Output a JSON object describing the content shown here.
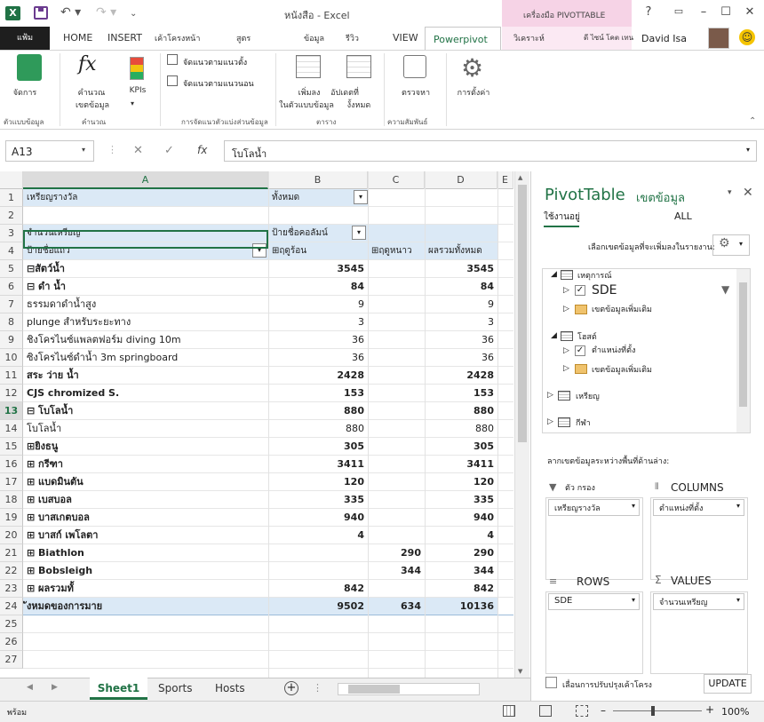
{
  "window": {
    "title": "หนังสือ - Excel",
    "context_tab": "เครื่องมือ PIVOTTABLE"
  },
  "tabs": {
    "file": "แฟ้ม",
    "home": "HOME",
    "insert": "INSERT",
    "layout": "เค้าโครงหน้า",
    "formulas": "สูตร",
    "data": "ข้อมูล",
    "review": "รีวิว",
    "view": "VIEW",
    "powerpivot": "Powerpivot",
    "analyze": "วิเคราะห์",
    "design": "ดี ไซน์ โคต เทน"
  },
  "user": {
    "name": "David Isa"
  },
  "ribbon": {
    "manage": "จัดการ",
    "group_model": "ตัวแบบข้อมูล",
    "calc": "คำนวณ",
    "calc_sub": "เขตข้อมูล",
    "kpis": "KPIs",
    "group_calc": "คำนวณ",
    "filter_col": "จัดแนวตามแนวตั้ง",
    "filter_row": "จัดแนวตามแนวนอน",
    "group_slicer": "การจัดแนวตัวแบ่งส่วนข้อมูล",
    "add_model": "เพิ่มลง",
    "add_model2": "ในตัวแบบข้อมูล",
    "update_all": "อัปเดตที่",
    "update_all2": "งั้งหมด",
    "group_table": "ตาราง",
    "detect": "ตรวจหา",
    "group_rel": "ความสัมพันธ์",
    "settings": "การตั้งค่า"
  },
  "formula_bar": {
    "name_box": "A13",
    "formula": "โบโลน้ำ"
  },
  "columns": [
    "A",
    "B",
    "C",
    "D",
    "E"
  ],
  "rows": [
    {
      "n": "1",
      "a": "เหรียญรางวัล",
      "b": "ทั้งหมด",
      "c": "",
      "d": "",
      "style": "filter"
    },
    {
      "n": "2",
      "a": "",
      "b": "",
      "c": "",
      "d": ""
    },
    {
      "n": "3",
      "a": "จำนวนเหรียญ",
      "b": "ป้ายชื่อคอลัมน์",
      "c": "",
      "d": "",
      "style": "head"
    },
    {
      "n": "4",
      "a": "ป้ายชื่อแถว",
      "b": "⊞ฤดูร้อน",
      "c": "⊞ฤดูหนาว",
      "d": "ผลรวมทั้งหมด",
      "style": "head"
    },
    {
      "n": "5",
      "a": "⊟สัตว์น้ำ",
      "b": "3545",
      "c": "",
      "d": "3545",
      "bold": true
    },
    {
      "n": "6",
      "a": "  ⊟ ดำ น้ำ",
      "b": "84",
      "c": "",
      "d": "84",
      "bold": true
    },
    {
      "n": "7",
      "a": "        ธรรมดาดำน้ำสูง",
      "b": "9",
      "c": "",
      "d": "9"
    },
    {
      "n": "8",
      "a": "        plunge สำหรับระยะทาง",
      "b": "3",
      "c": "",
      "d": "3"
    },
    {
      "n": "9",
      "a": "        ชิงโครไนซ์แพลตฟอร์ม diving 10m",
      "b": "36",
      "c": "",
      "d": "36"
    },
    {
      "n": "10",
      "a": "        ซิงโครไนซ์ดำน้ำ 3m springboard",
      "b": "36",
      "c": "",
      "d": "36"
    },
    {
      "n": "11",
      "a": "  สระ ว่าย น้ำ",
      "b": "2428",
      "c": "",
      "d": "2428",
      "bold": true
    },
    {
      "n": "12",
      "a": "  CJS chromized S.",
      "b": "153",
      "c": "",
      "d": "153",
      "bold": true
    },
    {
      "n": "13",
      "a": "  ⊟ โบโลน้ำ",
      "b": "880",
      "c": "",
      "d": "880",
      "bold": true
    },
    {
      "n": "14",
      "a": "        โบโลน้ำ",
      "b": "880",
      "c": "",
      "d": "880"
    },
    {
      "n": "15",
      "a": "⊞ยิงธนู",
      "b": "305",
      "c": "",
      "d": "305",
      "bold": true
    },
    {
      "n": "16",
      "a": "⊞ กรีฑา",
      "b": "3411",
      "c": "",
      "d": "3411",
      "bold": true
    },
    {
      "n": "17",
      "a": "⊞ แบดมินตัน",
      "b": "120",
      "c": "",
      "d": "120",
      "bold": true
    },
    {
      "n": "18",
      "a": "⊞ เบสบอล",
      "b": "335",
      "c": "",
      "d": "335",
      "bold": true
    },
    {
      "n": "19",
      "a": "⊞ บาสเกตบอล",
      "b": "940",
      "c": "",
      "d": "940",
      "bold": true
    },
    {
      "n": "20",
      "a": "⊞ บาสก์ เพโลตา",
      "b": "4",
      "c": "",
      "d": "4",
      "bold": true
    },
    {
      "n": "21",
      "a": "⊞ Biathlon",
      "b": "",
      "c": "290",
      "d": "290",
      "bold": true
    },
    {
      "n": "22",
      "a": "⊞ Bobsleigh",
      "b": "",
      "c": "344",
      "d": "344",
      "bold": true
    },
    {
      "n": "23",
      "a": "⊞ ผลรวมทั้",
      "b": "842",
      "c": "",
      "d": "842",
      "bold": true
    },
    {
      "n": "24",
      "a": "ังหมดของการมาย",
      "b": "9502",
      "c": "634",
      "d": "10136",
      "bold": true,
      "style": "total"
    },
    {
      "n": "25",
      "a": "",
      "b": "",
      "c": "",
      "d": ""
    },
    {
      "n": "26",
      "a": "",
      "b": "",
      "c": "",
      "d": ""
    },
    {
      "n": "27",
      "a": "",
      "b": "",
      "c": "",
      "d": ""
    }
  ],
  "sheets": [
    "Sheet1",
    "Sports",
    "Hosts"
  ],
  "status": {
    "mode": "พร้อม",
    "zoom": "100%"
  },
  "pivot_pane": {
    "title": "PivotTable",
    "title2": "เขตข้อมูล",
    "tab_active": "ใช้งานอยู่",
    "tab_all": "ALL",
    "choose_label": "เลือกเขตข้อมูลที่จะเพิ่มลงในรายงาน:",
    "fields": {
      "events": "เหตุการณ์",
      "sde": "SDE",
      "more1": "เขตข้อมูลเพิ่มเติม",
      "hosts": "โฮสต์",
      "position": "ตำแหน่งที่ตั้ง",
      "more2": "เขตข้อมูลเพิ่มเติม",
      "medals": "เหรียญ",
      "sports": "กีฬา"
    },
    "drag_label": "ลากเขตข้อมูลระหว่างพื้นที่ด้านล่าง:",
    "filters_title": "ตัว กรอง",
    "columns_title": "COLUMNS",
    "rows_title": "ROWS",
    "values_title": "VALUES",
    "filter_item": "เหรียญรางวัล",
    "column_item": "ตำแหน่งที่ตั้ง",
    "row_item": "SDE",
    "value_item": "จำนวนเหรียญ",
    "defer_label": "เลื่อนการปรับปรุงเค้าโครง",
    "update_button": "UPDATE"
  }
}
